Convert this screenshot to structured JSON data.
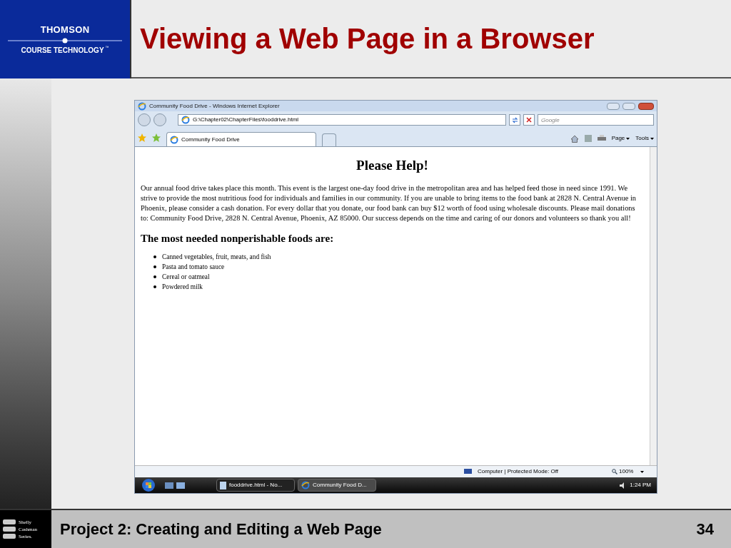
{
  "header": {
    "logo": {
      "line1": "THOMSON",
      "line2": "COURSE TECHNOLOGY",
      "mark": "™"
    },
    "title": "Viewing a Web Page in a Browser"
  },
  "browser": {
    "title": "Community Food Drive - Windows Internet Explorer",
    "address": "G:\\Chapter02\\ChapterFiles\\fooddrive.html",
    "search_placeholder": "Google",
    "tabs": [
      {
        "label": "Community Food Drive",
        "selected": true
      }
    ],
    "toolbar": [
      "Page",
      "Tools"
    ],
    "page": {
      "heading": "Please Help!",
      "paragraph": "Our annual food drive takes place this month. This event is the largest one-day food drive in the metropolitan area and has helped feed those in need since 1991. We strive to provide the most nutritious food for individuals and families in our community. If you are unable to bring items to the food bank at 2828 N. Central Avenue in Phoenix, please consider a cash donation. For every dollar that you donate, our food bank can buy $12 worth of food using wholesale discounts. Please mail donations to: Community Food Drive, 2828 N. Central Avenue, Phoenix, AZ 85000. Our success depends on the time and caring of our donors and volunteers so thank you all!",
      "subheading": "The most needed nonperishable foods are:",
      "items": [
        "Canned vegetables, fruit, meats, and fish",
        "Pasta and tomato sauce",
        "Cereal or oatmeal",
        "Powdered milk"
      ]
    },
    "status": {
      "zone": "Computer | Protected Mode: Off",
      "zoom": "100%"
    },
    "taskbar": {
      "tasks": [
        {
          "label": "fooddrive.html - No...",
          "kind": "notepad",
          "selected": false
        },
        {
          "label": "Community Food D...",
          "kind": "browser",
          "selected": true
        }
      ],
      "time": "1:24 PM"
    }
  },
  "footer": {
    "logo": [
      "Shelly",
      "Cashman",
      "Series."
    ],
    "title": "Project 2: Creating and Editing a Web Page",
    "page": "34"
  }
}
